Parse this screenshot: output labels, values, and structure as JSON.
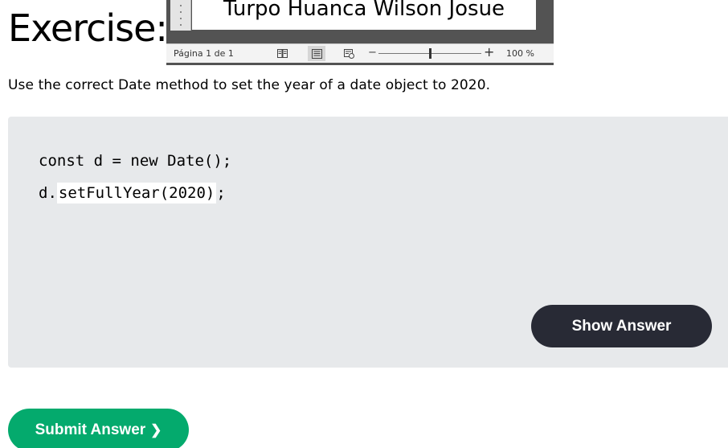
{
  "heading": "Exercise:",
  "doc_overlay": {
    "page_text": "Turpo Huanca Wilson Josue",
    "status_page": "Página 1 de 1",
    "zoom_level": "100 %",
    "zoom_minus": "−",
    "zoom_plus": "+",
    "zoom_fraction": 0.5
  },
  "instruction": "Use the correct Date method to set the year of a date object to 2020.",
  "code": {
    "line1": "const d = new Date();",
    "line2_prefix": "d.",
    "line2_input": "setFullYear(2020)",
    "line2_suffix": ";"
  },
  "buttons": {
    "show_answer": "Show Answer",
    "submit_answer": "Submit Answer",
    "submit_chevron": "❯"
  },
  "colors": {
    "code_panel_bg": "#e7e9eb",
    "show_answer_bg": "#282a35",
    "submit_answer_bg": "#04aa6d"
  }
}
